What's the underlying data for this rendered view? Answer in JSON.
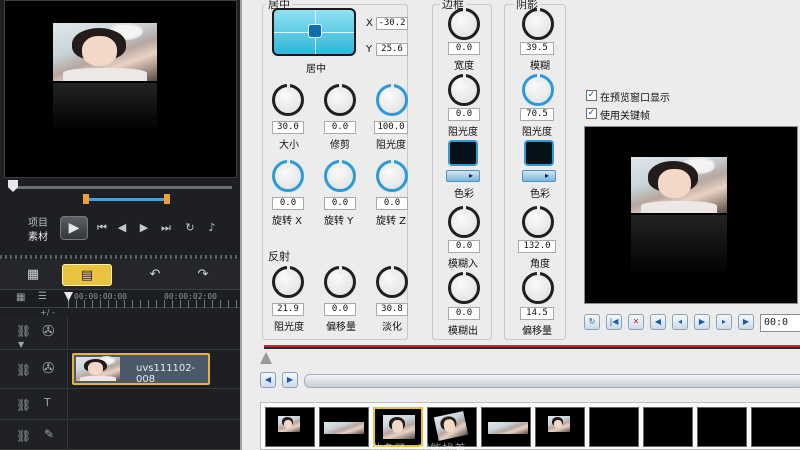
{
  "preview": {
    "label_project": "项目",
    "label_clip": "素材",
    "play_icon": "play-icon"
  },
  "timeline": {
    "ruler_start": "00:00:00:00",
    "ruler_mark": "00:00:02:00",
    "zoom_label": "+/ -",
    "clip_name": "uvs111102-008"
  },
  "panel": {
    "center": {
      "title": "居中",
      "button_label": "居中",
      "x_label": "X",
      "x_value": "-30.2",
      "y_label": "Y",
      "y_value": "25.6"
    },
    "size": {
      "label": "大小",
      "value": "30.0"
    },
    "crop": {
      "label": "修剪",
      "value": "0.0"
    },
    "opacity": {
      "label": "阻光度",
      "value": "100.0"
    },
    "rotate_x": {
      "label": "旋转 X",
      "value": "0.0"
    },
    "rotate_y": {
      "label": "旋转 Y",
      "value": "0.0"
    },
    "rotate_z": {
      "label": "旋转 Z",
      "value": "0.0"
    },
    "reflection": {
      "title": "反射",
      "opacity": {
        "label": "阻光度",
        "value": "21.9"
      },
      "offset": {
        "label": "偏移量",
        "value": "0.0"
      },
      "fade": {
        "label": "淡化",
        "value": "30.8"
      }
    },
    "border": {
      "title": "边框",
      "width": {
        "label": "宽度",
        "value": "0.0"
      },
      "opacity": {
        "label": "阻光度",
        "value": "0.0"
      },
      "color_label": "色彩",
      "blur_in": {
        "label": "模糊入",
        "value": "0.0"
      },
      "blur_out": {
        "label": "模糊出",
        "value": "0.0"
      }
    },
    "shadow": {
      "title": "阴影",
      "blur": {
        "label": "模糊",
        "value": "39.5"
      },
      "opacity": {
        "label": "阻光度",
        "value": "70.5"
      },
      "color_label": "色彩",
      "angle": {
        "label": "角度",
        "value": "132.0"
      },
      "offset": {
        "label": "偏移量",
        "value": "14.5"
      }
    },
    "show_in_preview": "在预览窗口显示",
    "use_keyframes": "使用关键帧",
    "mini_time": "00:0"
  },
  "watermark": "做多了，就能找着"
}
